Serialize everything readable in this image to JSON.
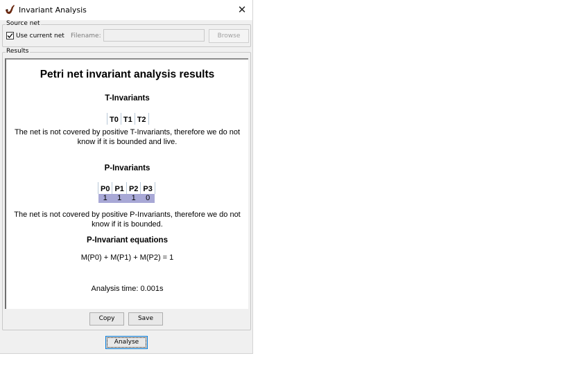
{
  "window": {
    "title": "Invariant Analysis",
    "close_symbol": "✕",
    "app_icon": "pipe-icon"
  },
  "source": {
    "group_label": "Source net",
    "use_current_net_label": "Use current net",
    "use_current_net_checked": true,
    "filename_label": "Filename:",
    "filename_value": "",
    "browse_label": "Browse"
  },
  "results": {
    "group_label": "Results",
    "title": "Petri net invariant analysis results",
    "t_invariants": {
      "heading": "T-Invariants",
      "columns": [
        "T0",
        "T1",
        "T2"
      ],
      "rows": [],
      "note": "The net is not covered by positive T-Invariants, therefore we do not know if it is bounded and live."
    },
    "p_invariants": {
      "heading": "P-Invariants",
      "columns": [
        "P0",
        "P1",
        "P2",
        "P3"
      ],
      "rows": [
        [
          "1",
          "1",
          "1",
          "0"
        ]
      ],
      "note": "The net is not covered by positive P-Invariants, therefore we do not know if it is bounded."
    },
    "equations_heading": "P-Invariant equations",
    "equation": "M(P0) + M(P1) + M(P2) = 1",
    "analysis_time": "Analysis time: 0.001s",
    "highlight_color": "#a8a8d6"
  },
  "buttons": {
    "copy": "Copy",
    "save": "Save",
    "analyse": "Analyse"
  }
}
